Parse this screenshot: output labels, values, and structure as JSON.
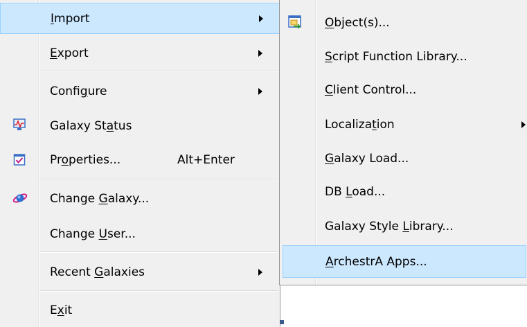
{
  "main_menu": {
    "items": [
      {
        "pre": "",
        "mn": "I",
        "post": "mport",
        "submenu": true
      },
      {
        "pre": "",
        "mn": "E",
        "post": "xport",
        "submenu": true
      },
      {
        "pre": "Confi",
        "mn": "g",
        "post": "ure",
        "submenu": true
      },
      {
        "pre": "Galaxy St",
        "mn": "a",
        "post": "tus",
        "icon": "galaxy-status-icon"
      },
      {
        "pre": "Pr",
        "mn": "o",
        "post": "perties...",
        "shortcut": "Alt+Enter",
        "icon": "properties-icon"
      },
      {
        "pre": "Change ",
        "mn": "G",
        "post": "alaxy...",
        "icon": "change-galaxy-icon"
      },
      {
        "pre": "Change ",
        "mn": "U",
        "post": "ser..."
      },
      {
        "pre": "Recent ",
        "mn": "G",
        "post": "alaxies",
        "submenu": true
      },
      {
        "pre": "E",
        "mn": "x",
        "post": "it"
      }
    ]
  },
  "import_submenu": {
    "items": [
      {
        "pre": "",
        "mn": "O",
        "post": "bject(s)...",
        "icon": "import-object-icon"
      },
      {
        "pre": "",
        "mn": "S",
        "post": "cript Function Library..."
      },
      {
        "pre": "",
        "mn": "C",
        "post": "lient Control..."
      },
      {
        "pre": "Localiza",
        "mn": "t",
        "post": "ion",
        "submenu": true
      },
      {
        "pre": "",
        "mn": "G",
        "post": "alaxy Load..."
      },
      {
        "pre": "DB ",
        "mn": "L",
        "post": "oad..."
      },
      {
        "pre": "Galaxy Style ",
        "mn": "L",
        "post": "ibrary..."
      },
      {
        "pre": "",
        "mn": "A",
        "post": "rchestrA Apps..."
      }
    ]
  },
  "colors": {
    "menu_bg": "#f0f0f0",
    "highlight_bg": "#cce8ff",
    "highlight_border": "#99d1ff",
    "separator": "#d7d7d7"
  }
}
